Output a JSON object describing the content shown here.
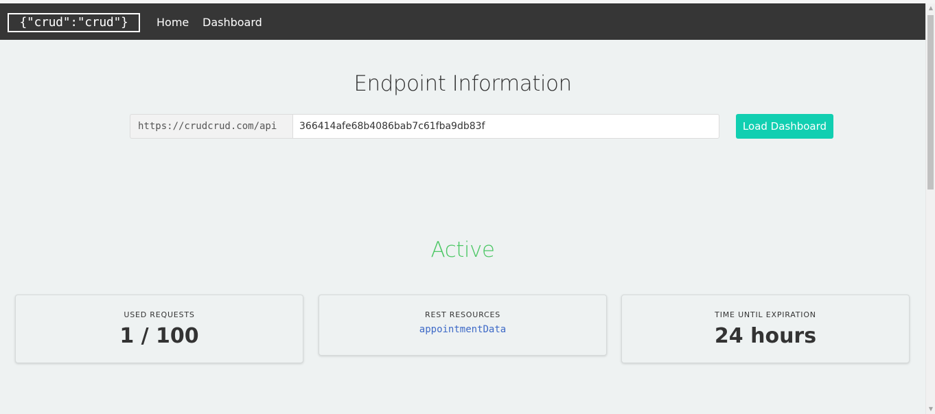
{
  "navbar": {
    "brand": "{\"crud\":\"crud\"}",
    "links": [
      "Home",
      "Dashboard"
    ]
  },
  "endpoint": {
    "title": "Endpoint Information",
    "prefix": "https://crudcrud.com/api",
    "key_value": "366414afe68b4086bab7c61fba9db83f",
    "load_button": "Load Dashboard"
  },
  "status": {
    "text": "Active",
    "color": "#4cc765"
  },
  "stats": {
    "used_requests": {
      "label": "USED REQUESTS",
      "value": "1 / 100"
    },
    "rest_resources": {
      "label": "REST RESOURCES",
      "items": [
        "appointmentData"
      ]
    },
    "expiration": {
      "label": "TIME UNTIL EXPIRATION",
      "value": "24 hours"
    }
  },
  "colors": {
    "navbar_bg": "#363636",
    "page_bg": "#eef2f2",
    "accent": "#11cfb1",
    "link": "#3e6ac7"
  },
  "icons": {
    "scroll_up": "scroll-up-arrow-icon",
    "scroll_down": "scroll-down-arrow-icon"
  }
}
